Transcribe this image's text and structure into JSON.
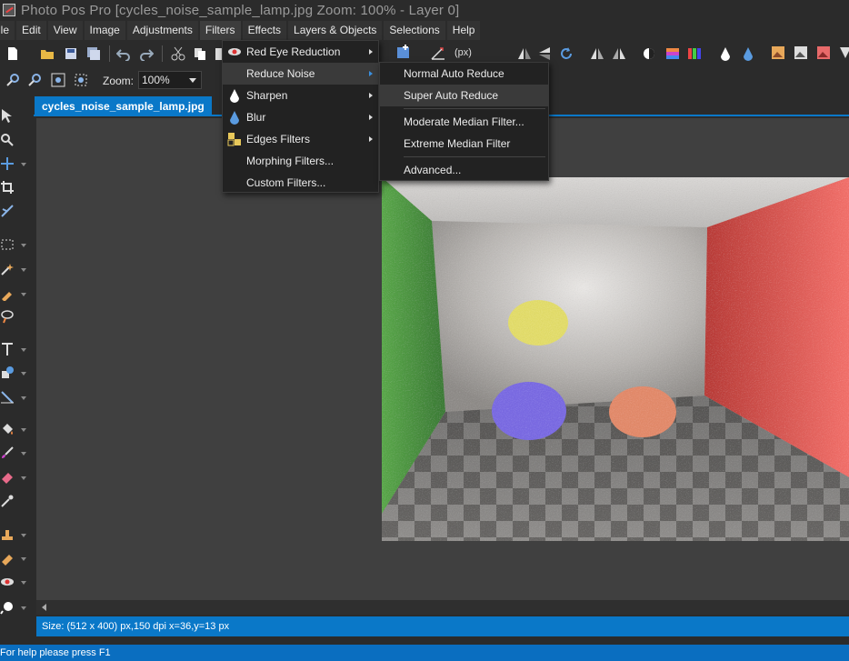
{
  "window": {
    "title": "Photo Pos Pro [cycles_noise_sample_lamp.jpg Zoom: 100% - Layer 0]"
  },
  "menubar": {
    "items": [
      "ile",
      "Edit",
      "View",
      "Image",
      "Adjustments",
      "Filters",
      "Effects",
      "Layers & Objects",
      "Selections",
      "Help"
    ],
    "active": "Filters"
  },
  "toolbar": {
    "zoom_label": "Zoom:",
    "zoom_value": "100%",
    "units_value": "(px)"
  },
  "document": {
    "tab_label": "cycles_noise_sample_lamp.jpg"
  },
  "filters_menu": {
    "items": [
      {
        "label": "Red Eye Reduction",
        "icon": "red-eye-icon",
        "submenu": true
      },
      {
        "label": "Reduce Noise",
        "icon": "",
        "submenu": true
      },
      {
        "label": "Sharpen",
        "icon": "sharpen-drop-icon",
        "submenu": true
      },
      {
        "label": "Blur",
        "icon": "blur-drop-icon",
        "submenu": true
      },
      {
        "label": "Edges Filters",
        "icon": "edges-icon",
        "submenu": true
      },
      {
        "label": "Morphing Filters...",
        "icon": "",
        "submenu": false
      },
      {
        "label": "Custom Filters...",
        "icon": "",
        "submenu": false
      }
    ],
    "highlighted": "Reduce Noise"
  },
  "reduce_noise_submenu": {
    "items": [
      "Normal Auto Reduce",
      "Super Auto Reduce",
      "Moderate Median Filter...",
      "Extreme Median Filter",
      "Advanced..."
    ],
    "highlighted": "Super Auto Reduce"
  },
  "status": {
    "info": "Size: (512 x 400) px,150 dpi   x=36,y=13 px",
    "help": "For help please press F1"
  },
  "colors": {
    "accent": "#0a78c8",
    "menu_bg": "#222222",
    "canvas_bg": "#404040",
    "chrome_bg": "#2b2b2b"
  }
}
